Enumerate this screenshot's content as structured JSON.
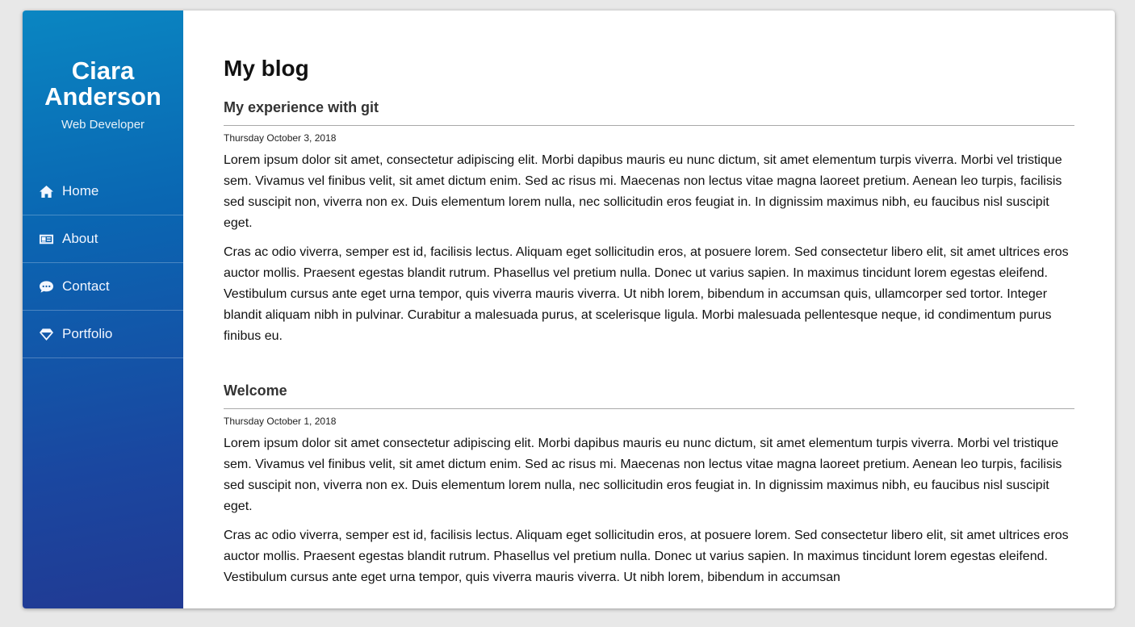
{
  "sidebar": {
    "name": "Ciara Anderson",
    "role": "Web Developer",
    "items": [
      {
        "label": "Home",
        "icon": "home-icon"
      },
      {
        "label": "About",
        "icon": "id-card-icon"
      },
      {
        "label": "Contact",
        "icon": "chat-bubble-icon"
      },
      {
        "label": "Portfolio",
        "icon": "diamond-icon"
      }
    ]
  },
  "main": {
    "title": "My blog",
    "posts": [
      {
        "title": "My experience with git",
        "date": "Thursday October 3, 2018",
        "paragraphs": [
          "Lorem ipsum dolor sit amet, consectetur adipiscing elit. Morbi dapibus mauris eu nunc dictum, sit amet elementum turpis viverra. Morbi vel tristique sem. Vivamus vel finibus velit, sit amet dictum enim. Sed ac risus mi. Maecenas non lectus vitae magna laoreet pretium. Aenean leo turpis, facilisis sed suscipit non, viverra non ex. Duis elementum lorem nulla, nec sollicitudin eros feugiat in. In dignissim maximus nibh, eu faucibus nisl suscipit eget.",
          "Cras ac odio viverra, semper est id, facilisis lectus. Aliquam eget sollicitudin eros, at posuere lorem. Sed consectetur libero elit, sit amet ultrices eros auctor mollis. Praesent egestas blandit rutrum. Phasellus vel pretium nulla. Donec ut varius sapien. In maximus tincidunt lorem egestas eleifend. Vestibulum cursus ante eget urna tempor, quis viverra mauris viverra. Ut nibh lorem, bibendum in accumsan quis, ullamcorper sed tortor. Integer blandit aliquam nibh in pulvinar. Curabitur a malesuada purus, at scelerisque ligula. Morbi malesuada pellentesque neque, id condimentum purus finibus eu."
        ]
      },
      {
        "title": "Welcome",
        "date": "Thursday October 1, 2018",
        "paragraphs": [
          "Lorem ipsum dolor sit amet consectetur adipiscing elit. Morbi dapibus mauris eu nunc dictum, sit amet elementum turpis viverra. Morbi vel tristique sem. Vivamus vel finibus velit, sit amet dictum enim. Sed ac risus mi. Maecenas non lectus vitae magna laoreet pretium. Aenean leo turpis, facilisis sed suscipit non, viverra non ex. Duis elementum lorem nulla, nec sollicitudin eros feugiat in. In dignissim maximus nibh, eu faucibus nisl suscipit eget.",
          "Cras ac odio viverra, semper est id, facilisis lectus. Aliquam eget sollicitudin eros, at posuere lorem. Sed consectetur libero elit, sit amet ultrices eros auctor mollis. Praesent egestas blandit rutrum. Phasellus vel pretium nulla. Donec ut varius sapien. In maximus tincidunt lorem egestas eleifend. Vestibulum cursus ante eget urna tempor, quis viverra mauris viverra. Ut nibh lorem, bibendum in accumsan"
        ]
      }
    ]
  },
  "colors": {
    "sidebar_top": "#0a86c2",
    "sidebar_bottom": "#213a93",
    "page_background": "#e8e8e8"
  }
}
